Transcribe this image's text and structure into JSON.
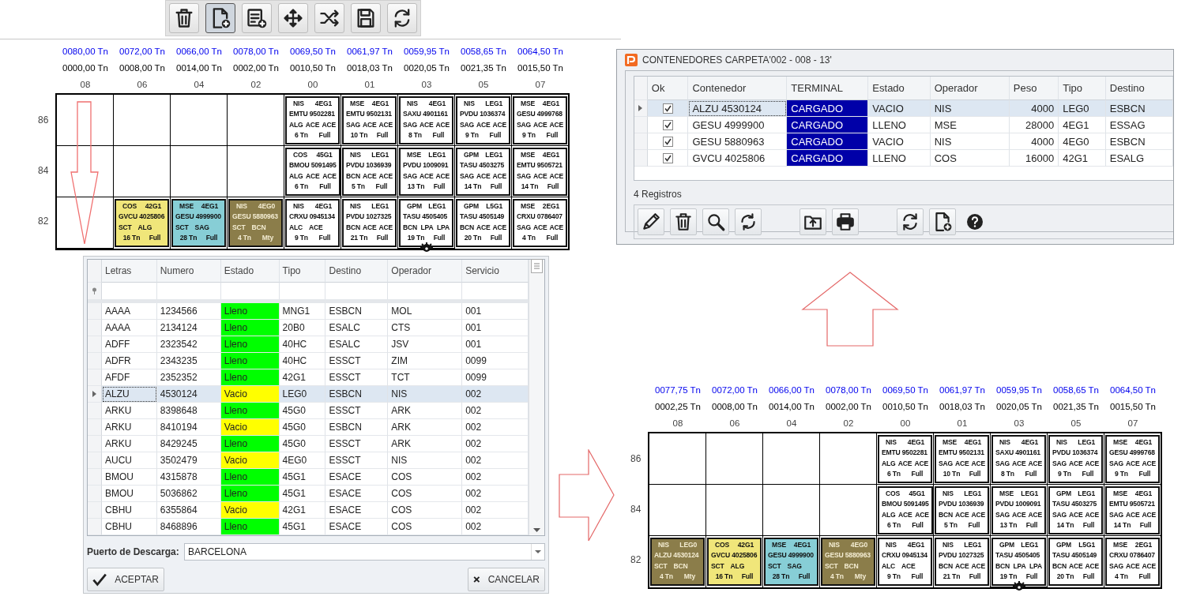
{
  "toolbar": {
    "buttons": [
      {
        "kind": "trash",
        "pressed": false
      },
      {
        "kind": "file-add",
        "pressed": true
      },
      {
        "kind": "list-add",
        "pressed": false
      },
      {
        "kind": "move",
        "pressed": false
      },
      {
        "kind": "shuffle",
        "pressed": false
      },
      {
        "kind": "save",
        "pressed": false
      },
      {
        "kind": "sync",
        "pressed": false
      }
    ]
  },
  "bay_plans": [
    {
      "row_labels": [
        "86",
        "84",
        "82"
      ],
      "bays": [
        {
          "label": "08",
          "max": "0080,00 Tn",
          "current": "0000,00 Tn",
          "arrow": true,
          "cog": false,
          "slots": [
            {
              "kind": "empty"
            },
            {
              "kind": "empty"
            },
            {
              "kind": "empty"
            }
          ]
        },
        {
          "label": "06",
          "max": "0072,00 Tn",
          "current": "0008,00 Tn",
          "arrow": false,
          "cog": false,
          "slots": [
            {
              "kind": "empty"
            },
            {
              "kind": "empty"
            },
            {
              "kind": "container",
              "operator": "COS",
              "type": "42G1",
              "id": "GVCU 4025806",
              "ports": [
                "SCT",
                "ALG"
              ],
              "weight": "16 Tn",
              "status": "Full",
              "color": "#f0e67a"
            }
          ]
        },
        {
          "label": "04",
          "max": "0066,00 Tn",
          "current": "0014,00 Tn",
          "arrow": false,
          "cog": false,
          "slots": [
            {
              "kind": "empty"
            },
            {
              "kind": "empty"
            },
            {
              "kind": "container",
              "operator": "MSE",
              "type": "4EG1",
              "id": "GESU 4999900",
              "ports": [
                "SCT",
                "SAG"
              ],
              "weight": "28 Tn",
              "status": "Full",
              "color": "#87ced6"
            }
          ]
        },
        {
          "label": "02",
          "max": "0078,00 Tn",
          "current": "0002,00 Tn",
          "arrow": false,
          "cog": false,
          "slots": [
            {
              "kind": "empty"
            },
            {
              "kind": "empty"
            },
            {
              "kind": "container",
              "operator": "NIS",
              "type": "4EG0",
              "id": "GESU 5880963",
              "ports": [
                "SCT",
                "BCN"
              ],
              "weight": "4 Tn",
              "status": "Mty",
              "color": "#8b7d4a"
            }
          ]
        },
        {
          "label": "00",
          "max": "0069,50 Tn",
          "current": "0010,50 Tn",
          "arrow": false,
          "cog": false,
          "slots": [
            {
              "kind": "container",
              "operator": "NIS",
              "type": "4EG1",
              "id": "EMTU 9502281",
              "ports": [
                "ALG",
                "ACE",
                "ACE"
              ],
              "weight": "6 Tn",
              "status": "Full",
              "color": "#ffffff"
            },
            {
              "kind": "container",
              "operator": "COS",
              "type": "45G1",
              "id": "BMOU 5091495",
              "ports": [
                "ALG",
                "ACE",
                "ACE"
              ],
              "weight": "6 Tn",
              "status": "Full",
              "color": "#ffffff"
            },
            {
              "kind": "container",
              "operator": "NIS",
              "type": "4EG1",
              "id": "CRXU 0945134",
              "ports": [
                "ALC",
                "ACE"
              ],
              "weight": "9 Tn",
              "status": "Full",
              "color": "#ffffff"
            }
          ]
        },
        {
          "label": "01",
          "max": "0061,97 Tn",
          "current": "0018,03 Tn",
          "arrow": false,
          "cog": false,
          "slots": [
            {
              "kind": "container",
              "operator": "MSE",
              "type": "4EG1",
              "id": "EMTU 9502131",
              "ports": [
                "SAG",
                "ACE",
                "ACE"
              ],
              "weight": "10 Tn",
              "status": "Full",
              "color": "#ffffff"
            },
            {
              "kind": "container",
              "operator": "NIS",
              "type": "LEG1",
              "id": "PVDU 1036939",
              "ports": [
                "BCN",
                "ACE",
                "ACE"
              ],
              "weight": "5 Tn",
              "status": "Full",
              "color": "#ffffff"
            },
            {
              "kind": "container",
              "operator": "NIS",
              "type": "LEG1",
              "id": "PVDU 1027325",
              "ports": [
                "BCN",
                "ACE",
                "ACE"
              ],
              "weight": "21 Tn",
              "status": "Full",
              "color": "#ffffff"
            }
          ]
        },
        {
          "label": "03",
          "max": "0059,95 Tn",
          "current": "0020,05 Tn",
          "arrow": false,
          "cog": true,
          "slots": [
            {
              "kind": "container",
              "operator": "NIS",
              "type": "4EG1",
              "id": "SAXU 4901161",
              "ports": [
                "SAG",
                "ACE",
                "ACE"
              ],
              "weight": "8 Tn",
              "status": "Full",
              "color": "#ffffff"
            },
            {
              "kind": "container",
              "operator": "MSE",
              "type": "LEG1",
              "id": "PVDU 1009091",
              "ports": [
                "SAG",
                "ACE",
                "ACE"
              ],
              "weight": "13 Tn",
              "status": "Full",
              "color": "#ffffff"
            },
            {
              "kind": "container",
              "operator": "GPM",
              "type": "LEG1",
              "id": "TASU 4505405",
              "ports": [
                "BCN",
                "LPA",
                "LPA"
              ],
              "weight": "19 Tn",
              "status": "Full",
              "color": "#ffffff"
            }
          ]
        },
        {
          "label": "05",
          "max": "0058,65 Tn",
          "current": "0021,35 Tn",
          "arrow": false,
          "cog": false,
          "slots": [
            {
              "kind": "container",
              "operator": "NIS",
              "type": "LEG1",
              "id": "PVDU 1036374",
              "ports": [
                "SAG",
                "ACE",
                "ACE"
              ],
              "weight": "9 Tn",
              "status": "Full",
              "color": "#ffffff"
            },
            {
              "kind": "container",
              "operator": "GPM",
              "type": "LEG1",
              "id": "TASU 4503275",
              "ports": [
                "SAG",
                "ACE",
                "ACE"
              ],
              "weight": "14 Tn",
              "status": "Full",
              "color": "#ffffff"
            },
            {
              "kind": "container",
              "operator": "GPM",
              "type": "L5G1",
              "id": "TASU 4505149",
              "ports": [
                "BCN",
                "ACE",
                "ACE"
              ],
              "weight": "20 Tn",
              "status": "Full",
              "color": "#ffffff"
            }
          ]
        },
        {
          "label": "07",
          "max": "0064,50 Tn",
          "current": "0015,50 Tn",
          "arrow": false,
          "cog": false,
          "slots": [
            {
              "kind": "container",
              "operator": "MSE",
              "type": "4EG1",
              "id": "GESU 4999768",
              "ports": [
                "SAG",
                "ACE",
                "ACE"
              ],
              "weight": "9 Tn",
              "status": "Full",
              "color": "#ffffff"
            },
            {
              "kind": "container",
              "operator": "MSE",
              "type": "4EG1",
              "id": "EMTU 9505721",
              "ports": [
                "SAG",
                "ACE",
                "ACE"
              ],
              "weight": "14 Tn",
              "status": "Full",
              "color": "#ffffff"
            },
            {
              "kind": "container",
              "operator": "MSE",
              "type": "2EG1",
              "id": "CRXU 0786407",
              "ports": [
                "SAG",
                "ACE",
                "ACE"
              ],
              "weight": "4 Tn",
              "status": "Full",
              "color": "#ffffff"
            }
          ]
        }
      ]
    },
    {
      "row_labels": [
        "86",
        "84",
        "82"
      ],
      "bays": [
        {
          "label": "08",
          "max": "0077,75 Tn",
          "current": "0002,25 Tn",
          "arrow": false,
          "cog": false,
          "slots": [
            {
              "kind": "empty"
            },
            {
              "kind": "empty"
            },
            {
              "kind": "container",
              "operator": "NIS",
              "type": "LEG0",
              "id": "ALZU 4530124",
              "ports": [
                "SCT",
                "BCN"
              ],
              "weight": "4 Tn",
              "status": "Mty",
              "color": "#8b7d4a"
            }
          ]
        },
        {
          "label": "06",
          "max": "0072,00 Tn",
          "current": "0008,00 Tn",
          "arrow": false,
          "cog": false,
          "slots": [
            {
              "kind": "empty"
            },
            {
              "kind": "empty"
            },
            {
              "kind": "container",
              "operator": "COS",
              "type": "42G1",
              "id": "GVCU 4025806",
              "ports": [
                "SCT",
                "ALG"
              ],
              "weight": "16 Tn",
              "status": "Full",
              "color": "#f0e67a"
            }
          ]
        },
        {
          "label": "04",
          "max": "0066,00 Tn",
          "current": "0014,00 Tn",
          "arrow": false,
          "cog": false,
          "slots": [
            {
              "kind": "empty"
            },
            {
              "kind": "empty"
            },
            {
              "kind": "container",
              "operator": "MSE",
              "type": "4EG1",
              "id": "GESU 4999900",
              "ports": [
                "SCT",
                "SAG"
              ],
              "weight": "28 Tn",
              "status": "Full",
              "color": "#87ced6"
            }
          ]
        },
        {
          "label": "02",
          "max": "0078,00 Tn",
          "current": "0002,00 Tn",
          "arrow": false,
          "cog": false,
          "slots": [
            {
              "kind": "empty"
            },
            {
              "kind": "empty"
            },
            {
              "kind": "container",
              "operator": "NIS",
              "type": "4EG0",
              "id": "GESU 5880963",
              "ports": [
                "SCT",
                "BCN"
              ],
              "weight": "4 Tn",
              "status": "Mty",
              "color": "#8b7d4a"
            }
          ]
        },
        {
          "label": "00",
          "max": "0069,50 Tn",
          "current": "0010,50 Tn",
          "arrow": false,
          "cog": false,
          "slots": [
            {
              "kind": "container",
              "operator": "NIS",
              "type": "4EG1",
              "id": "EMTU 9502281",
              "ports": [
                "ALG",
                "ACE",
                "ACE"
              ],
              "weight": "6 Tn",
              "status": "Full",
              "color": "#ffffff"
            },
            {
              "kind": "container",
              "operator": "COS",
              "type": "45G1",
              "id": "BMOU 5091495",
              "ports": [
                "ALG",
                "ACE",
                "ACE"
              ],
              "weight": "6 Tn",
              "status": "Full",
              "color": "#ffffff"
            },
            {
              "kind": "container",
              "operator": "NIS",
              "type": "4EG1",
              "id": "CRXU 0945134",
              "ports": [
                "ALC",
                "ACE"
              ],
              "weight": "9 Tn",
              "status": "Full",
              "color": "#ffffff"
            }
          ]
        },
        {
          "label": "01",
          "max": "0061,97 Tn",
          "current": "0018,03 Tn",
          "arrow": false,
          "cog": false,
          "slots": [
            {
              "kind": "container",
              "operator": "MSE",
              "type": "4EG1",
              "id": "EMTU 9502131",
              "ports": [
                "SAG",
                "ACE",
                "ACE"
              ],
              "weight": "10 Tn",
              "status": "Full",
              "color": "#ffffff"
            },
            {
              "kind": "container",
              "operator": "NIS",
              "type": "LEG1",
              "id": "PVDU 1036939",
              "ports": [
                "BCN",
                "ACE",
                "ACE"
              ],
              "weight": "5 Tn",
              "status": "Full",
              "color": "#ffffff"
            },
            {
              "kind": "container",
              "operator": "NIS",
              "type": "LEG1",
              "id": "PVDU 1027325",
              "ports": [
                "BCN",
                "ACE",
                "ACE"
              ],
              "weight": "21 Tn",
              "status": "Full",
              "color": "#ffffff"
            }
          ]
        },
        {
          "label": "03",
          "max": "0059,95 Tn",
          "current": "0020,05 Tn",
          "arrow": false,
          "cog": true,
          "slots": [
            {
              "kind": "container",
              "operator": "NIS",
              "type": "4EG1",
              "id": "SAXU 4901161",
              "ports": [
                "SAG",
                "ACE",
                "ACE"
              ],
              "weight": "8 Tn",
              "status": "Full",
              "color": "#ffffff"
            },
            {
              "kind": "container",
              "operator": "MSE",
              "type": "LEG1",
              "id": "PVDU 1009091",
              "ports": [
                "SAG",
                "ACE",
                "ACE"
              ],
              "weight": "13 Tn",
              "status": "Full",
              "color": "#ffffff"
            },
            {
              "kind": "container",
              "operator": "GPM",
              "type": "LEG1",
              "id": "TASU 4505405",
              "ports": [
                "BCN",
                "LPA",
                "LPA"
              ],
              "weight": "19 Tn",
              "status": "Full",
              "color": "#ffffff"
            }
          ]
        },
        {
          "label": "05",
          "max": "0058,65 Tn",
          "current": "0021,35 Tn",
          "arrow": false,
          "cog": false,
          "slots": [
            {
              "kind": "container",
              "operator": "NIS",
              "type": "LEG1",
              "id": "PVDU 1036374",
              "ports": [
                "SAG",
                "ACE",
                "ACE"
              ],
              "weight": "9 Tn",
              "status": "Full",
              "color": "#ffffff"
            },
            {
              "kind": "container",
              "operator": "GPM",
              "type": "LEG1",
              "id": "TASU 4503275",
              "ports": [
                "SAG",
                "ACE",
                "ACE"
              ],
              "weight": "14 Tn",
              "status": "Full",
              "color": "#ffffff"
            },
            {
              "kind": "container",
              "operator": "GPM",
              "type": "L5G1",
              "id": "TASU 4505149",
              "ports": [
                "BCN",
                "ACE",
                "ACE"
              ],
              "weight": "20 Tn",
              "status": "Full",
              "color": "#ffffff"
            }
          ]
        },
        {
          "label": "07",
          "max": "0064,50 Tn",
          "current": "0015,50 Tn",
          "arrow": false,
          "cog": false,
          "slots": [
            {
              "kind": "container",
              "operator": "MSE",
              "type": "4EG1",
              "id": "GESU 4999768",
              "ports": [
                "SAG",
                "ACE",
                "ACE"
              ],
              "weight": "9 Tn",
              "status": "Full",
              "color": "#ffffff"
            },
            {
              "kind": "container",
              "operator": "MSE",
              "type": "4EG1",
              "id": "EMTU 9505721",
              "ports": [
                "SAG",
                "ACE",
                "ACE"
              ],
              "weight": "14 Tn",
              "status": "Full",
              "color": "#ffffff"
            },
            {
              "kind": "container",
              "operator": "MSE",
              "type": "2EG1",
              "id": "CRXU 0786407",
              "ports": [
                "SAG",
                "ACE",
                "ACE"
              ],
              "weight": "4 Tn",
              "status": "Full",
              "color": "#ffffff"
            }
          ]
        }
      ]
    }
  ],
  "cargo_dialog": {
    "columns": [
      "Letras",
      "Numero",
      "Estado",
      "Tipo",
      "Destino",
      "Operador",
      "Servicio"
    ],
    "rows": [
      {
        "letras": "AAAA",
        "numero": "1234566",
        "estado": {
          "text": "Lleno",
          "color": "#00ff00"
        },
        "tipo": "MNG1",
        "destino": "ESBCN",
        "operador": "MOL",
        "servicio": "001",
        "selected": false
      },
      {
        "letras": "AAAA",
        "numero": "2134124",
        "estado": {
          "text": "Lleno",
          "color": "#00ff00"
        },
        "tipo": "20B0",
        "destino": "ESALC",
        "operador": "CTS",
        "servicio": "001",
        "selected": false
      },
      {
        "letras": "ADFF",
        "numero": "2323542",
        "estado": {
          "text": "Lleno",
          "color": "#00ff00"
        },
        "tipo": "40HC",
        "destino": "ESALC",
        "operador": "JSV",
        "servicio": "001",
        "selected": false
      },
      {
        "letras": "ADFR",
        "numero": "2343235",
        "estado": {
          "text": "Lleno",
          "color": "#00ff00"
        },
        "tipo": "40HC",
        "destino": "ESSCT",
        "operador": "ZIM",
        "servicio": "0099",
        "selected": false
      },
      {
        "letras": "AFDF",
        "numero": "2352352",
        "estado": {
          "text": "Lleno",
          "color": "#00ff00"
        },
        "tipo": "42G1",
        "destino": "ESSCT",
        "operador": "TCT",
        "servicio": "0099",
        "selected": false
      },
      {
        "letras": "ALZU",
        "numero": "4530124",
        "estado": {
          "text": "Vacio",
          "color": "#ffff00"
        },
        "tipo": "LEG0",
        "destino": "ESBCN",
        "operador": "NIS",
        "servicio": "002",
        "selected": true
      },
      {
        "letras": "ARKU",
        "numero": "8398648",
        "estado": {
          "text": "Lleno",
          "color": "#00ff00"
        },
        "tipo": "45G0",
        "destino": "ESSCT",
        "operador": "ARK",
        "servicio": "002",
        "selected": false
      },
      {
        "letras": "ARKU",
        "numero": "8410194",
        "estado": {
          "text": "Vacio",
          "color": "#ffff00"
        },
        "tipo": "45G0",
        "destino": "ESBCN",
        "operador": "ARK",
        "servicio": "002",
        "selected": false
      },
      {
        "letras": "ARKU",
        "numero": "8429245",
        "estado": {
          "text": "Lleno",
          "color": "#00ff00"
        },
        "tipo": "45G0",
        "destino": "ESSCT",
        "operador": "ARK",
        "servicio": "002",
        "selected": false
      },
      {
        "letras": "AUCU",
        "numero": "3502479",
        "estado": {
          "text": "Vacio",
          "color": "#ffff00"
        },
        "tipo": "4EG0",
        "destino": "ESSCT",
        "operador": "NIS",
        "servicio": "002",
        "selected": false
      },
      {
        "letras": "BMOU",
        "numero": "4315878",
        "estado": {
          "text": "Lleno",
          "color": "#00ff00"
        },
        "tipo": "45G1",
        "destino": "ESACE",
        "operador": "COS",
        "servicio": "002",
        "selected": false
      },
      {
        "letras": "BMOU",
        "numero": "5036862",
        "estado": {
          "text": "Lleno",
          "color": "#00ff00"
        },
        "tipo": "45G1",
        "destino": "ESACE",
        "operador": "COS",
        "servicio": "002",
        "selected": false
      },
      {
        "letras": "CBHU",
        "numero": "6355864",
        "estado": {
          "text": "Vacio",
          "color": "#ffff00"
        },
        "tipo": "42G1",
        "destino": "ESACE",
        "operador": "COS",
        "servicio": "002",
        "selected": false
      },
      {
        "letras": "CBHU",
        "numero": "8468896",
        "estado": {
          "text": "Lleno",
          "color": "#00ff00"
        },
        "tipo": "45G1",
        "destino": "ESACE",
        "operador": "COS",
        "servicio": "002",
        "selected": false
      }
    ],
    "port_label": "Puerto de Descarga:",
    "port_value": "BARCELONA",
    "accept": "ACEPTAR",
    "cancel": "CANCELAR"
  },
  "container_dialog": {
    "title": "CONTENEDORES CARPETA'002 - 008 - 13'",
    "columns": [
      "Ok",
      "Contenedor",
      "TERMINAL",
      "Estado",
      "Operador",
      "Peso",
      "Tipo",
      "Destino"
    ],
    "rows": [
      {
        "ok": true,
        "contenedor": "ALZU 4530124",
        "terminal": "CARGADO",
        "estado": "VACIO",
        "operador": "NIS",
        "peso": "4000",
        "tipo": "LEG0",
        "destino": "ESBCN",
        "selected": true
      },
      {
        "ok": true,
        "contenedor": "GESU 4999900",
        "terminal": "CARGADO",
        "estado": "LLENO",
        "operador": "MSE",
        "peso": "28000",
        "tipo": "4EG1",
        "destino": "ESSAG",
        "selected": false
      },
      {
        "ok": true,
        "contenedor": "GESU 5880963",
        "terminal": "CARGADO",
        "estado": "VACIO",
        "operador": "NIS",
        "peso": "4000",
        "tipo": "4EG0",
        "destino": "ESBCN",
        "selected": false
      },
      {
        "ok": true,
        "contenedor": "GVCU 4025806",
        "terminal": "CARGADO",
        "estado": "LLENO",
        "operador": "COS",
        "peso": "16000",
        "tipo": "42G1",
        "destino": "ESALG",
        "selected": false
      }
    ],
    "record_count": "4 Registros",
    "toolbar": [
      [
        {
          "kind": "pencil"
        },
        {
          "kind": "trash"
        },
        {
          "kind": "search"
        },
        {
          "kind": "refresh"
        }
      ],
      [
        {
          "kind": "upload"
        },
        {
          "kind": "print"
        }
      ],
      [
        {
          "kind": "sync"
        },
        {
          "kind": "file-add"
        },
        {
          "kind": "help"
        }
      ]
    ]
  }
}
